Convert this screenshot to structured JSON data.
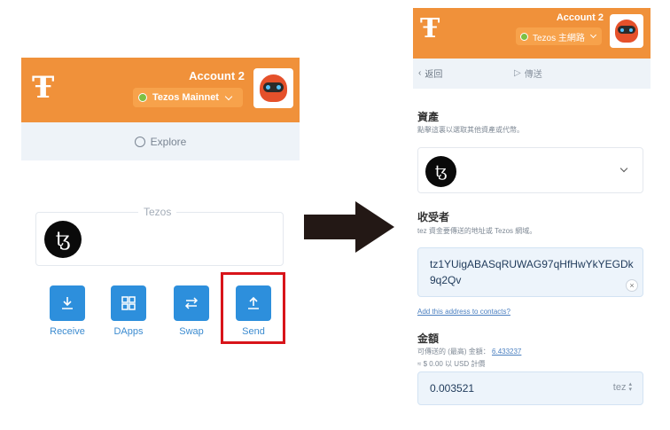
{
  "left": {
    "account_name": "Account 2",
    "network_label": "Tezos Mainnet",
    "explore_label": "Explore",
    "token_section_label": "Tezos",
    "actions": [
      {
        "label": "Receive",
        "icon": "download-icon"
      },
      {
        "label": "DApps",
        "icon": "grid-icon"
      },
      {
        "label": "Swap",
        "icon": "swap-icon"
      },
      {
        "label": "Send",
        "icon": "upload-icon"
      }
    ]
  },
  "right": {
    "account_name": "Account 2",
    "network_label": "Tezos 主網路",
    "back_label": "返回",
    "title": "傳送",
    "asset_heading": "資產",
    "asset_hint": "點擊這裏以選取其他資產或代幣。",
    "recipient_heading": "收受者",
    "recipient_hint": "tez 資金要傳送的地址或 Tezos 網域。",
    "recipient_value": "tz1YUigABASqRUWAG97qHfHwYkYEGDk9q2Qv",
    "add_contact_link": "Add this address to contacts?",
    "amount_heading": "金額",
    "amount_available_prefix": "可傳送的 (最高) 金額：",
    "amount_available_value": "6.433237",
    "amount_usd_hint": "≈ $ 0.00 以 USD 計價",
    "amount_value": "0.003521",
    "amount_unit": "tez"
  },
  "colors": {
    "header_orange": "#f0913a",
    "highlight_red": "#d8141a",
    "action_blue": "#2d8fdc",
    "arrow": "#231815"
  }
}
